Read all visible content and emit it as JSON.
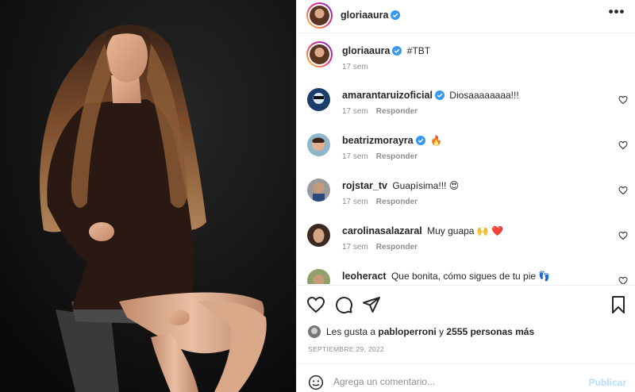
{
  "header": {
    "username": "gloriaaura"
  },
  "caption": {
    "username": "gloriaaura",
    "text": "#TBT",
    "time": "17 sem"
  },
  "comments": [
    {
      "username": "amarantaruizoficial",
      "verified": true,
      "text": "Diosaaaaaaaa!!!",
      "time": "17 sem",
      "reply": "Responder"
    },
    {
      "username": "beatrizmorayra",
      "verified": true,
      "text": "🔥",
      "time": "17 sem",
      "reply": "Responder"
    },
    {
      "username": "rojstar_tv",
      "verified": false,
      "text": "Guapísima!!! 😍",
      "time": "17 sem",
      "reply": "Responder"
    },
    {
      "username": "carolinasalazaral",
      "verified": false,
      "text": "Muy guapa 🙌 ❤️",
      "time": "17 sem",
      "reply": "Responder"
    },
    {
      "username": "leoheract",
      "verified": false,
      "text": "Que bonita, cómo sigues de tu pie 👣",
      "time": "",
      "reply": ""
    }
  ],
  "likes": {
    "prefix": "Les gusta a",
    "user": "pabloperroni",
    "connector": "y",
    "count": "2555 personas más"
  },
  "date": "SEPTIEMBRE 29, 2022",
  "add_comment": {
    "placeholder": "Agrega un comentario...",
    "publish": "Publicar"
  },
  "icons": {
    "more": "more-horizontal-icon",
    "verified": "verified-badge-icon",
    "heart": "heart-icon",
    "comment": "comment-icon",
    "share": "send-icon",
    "save": "bookmark-icon",
    "emoji": "emoji-smiley-icon"
  },
  "colors": {
    "verified": "#3897f0",
    "link": "#b2dffc",
    "muted": "#8e8e8e",
    "text": "#262626",
    "heart_red": "#ed4956"
  }
}
